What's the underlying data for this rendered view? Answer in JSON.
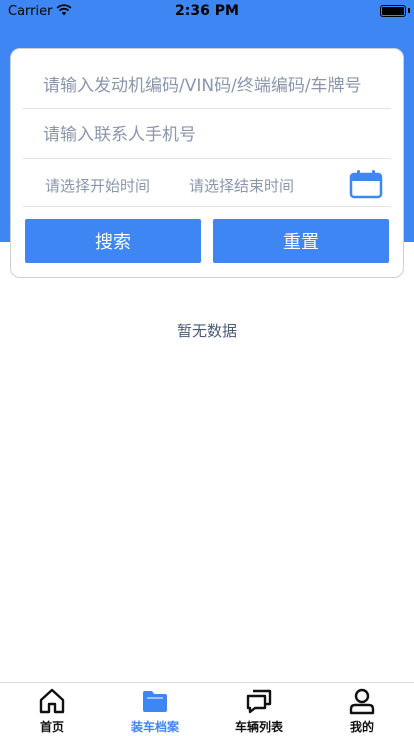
{
  "status_bar": {
    "carrier": "Carrier",
    "time": "2:36 PM",
    "battery_level": 1.0
  },
  "search": {
    "vehicle_placeholder": "请输入发动机编码/VIN码/终端编码/车牌号",
    "vehicle_value": "",
    "phone_placeholder": "请输入联系人手机号",
    "phone_value": "",
    "start_date_placeholder": "请选择开始时间",
    "end_date_placeholder": "请选择结束时间",
    "calendar_icon": "calendar-icon",
    "search_button": "搜索",
    "reset_button": "重置"
  },
  "empty_state": "暂无数据",
  "tab_bar": {
    "items": [
      {
        "label": "首页",
        "icon": "home-icon",
        "active": false
      },
      {
        "label": "装车档案",
        "icon": "folder-icon",
        "active": true
      },
      {
        "label": "车辆列表",
        "icon": "chat-icon",
        "active": false
      },
      {
        "label": "我的",
        "icon": "user-icon",
        "active": false
      }
    ]
  },
  "colors": {
    "primary": "#3d86f4",
    "placeholder": "#8a96ad",
    "empty_text": "#4a5a78"
  }
}
